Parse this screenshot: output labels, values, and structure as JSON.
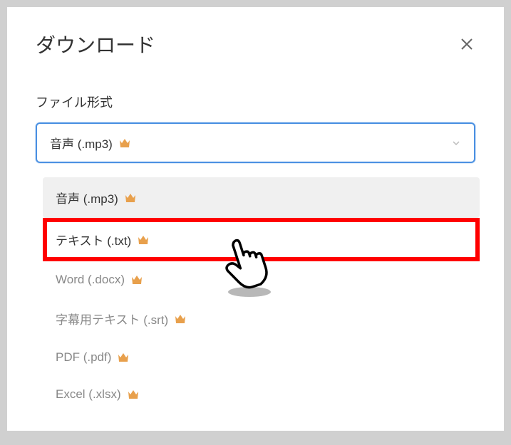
{
  "modal": {
    "title": "ダウンロード",
    "field_label": "ファイル形式",
    "selected_value": "音声 (.mp3)",
    "options": [
      {
        "label": "音声 (.mp3)",
        "selected": true,
        "highlighted": false
      },
      {
        "label": "テキスト (.txt)",
        "selected": false,
        "highlighted": true
      },
      {
        "label": "Word (.docx)",
        "selected": false,
        "highlighted": false
      },
      {
        "label": "字幕用テキスト (.srt)",
        "selected": false,
        "highlighted": false
      },
      {
        "label": "PDF (.pdf)",
        "selected": false,
        "highlighted": false
      },
      {
        "label": "Excel (.xlsx)",
        "selected": false,
        "highlighted": false
      }
    ]
  }
}
